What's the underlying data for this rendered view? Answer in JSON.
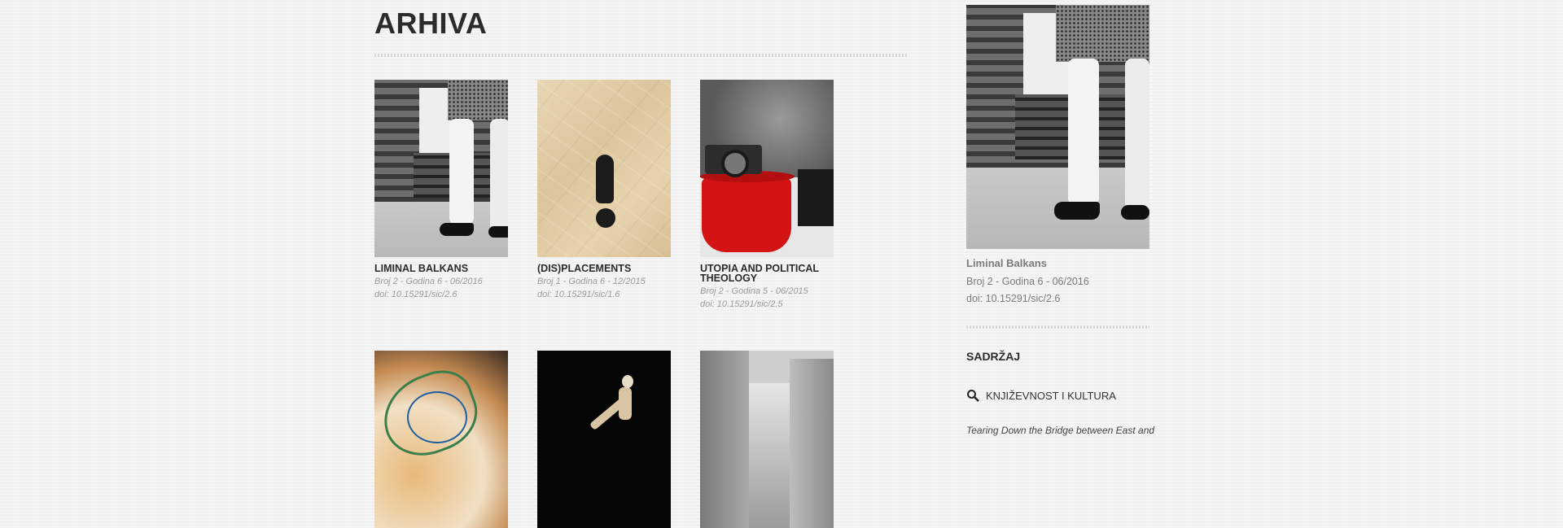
{
  "page": {
    "title": "ARHIVA"
  },
  "issues": [
    {
      "title": "LIMINAL BALKANS",
      "meta": "Broj 2 - Godina 6 - 06/2016",
      "doi": "doi: 10.15291/sic/2.6",
      "image": "legs-at-train"
    },
    {
      "title": "(DIS)PLACEMENTS",
      "meta": "Broj 1 - Godina 6 - 12/2015",
      "doi": "doi: 10.15291/sic/1.6",
      "image": "exclamation-mark-paper"
    },
    {
      "title": "UTOPIA AND POLITICAL THEOLOGY",
      "meta": "Broj 2 - Godina 5 - 06/2015",
      "doi": "doi: 10.15291/sic/2.5",
      "image": "camera-on-red-pot"
    },
    {
      "title": "",
      "meta": "",
      "doi": "",
      "image": "abstract-colors"
    },
    {
      "title": "",
      "meta": "",
      "doi": "",
      "image": "wooden-figure"
    },
    {
      "title": "",
      "meta": "",
      "doi": "",
      "image": "city-street"
    }
  ],
  "sidebar": {
    "current_title": "Liminal Balkans",
    "current_meta": "Broj 2 - Godina 6 - 06/2016",
    "current_doi": "doi: 10.15291/sic/2.6",
    "contents_heading": "SADRŽAJ",
    "category_icon": "magnifier-icon",
    "category_label": "KNJIŽEVNOST I KULTURA",
    "first_article": "Tearing Down the Bridge between East and"
  },
  "colors": {
    "text": "#2b2b2b",
    "muted": "#9a9a9a",
    "background": "#f2f2f2",
    "accent_red": "#d41414"
  }
}
